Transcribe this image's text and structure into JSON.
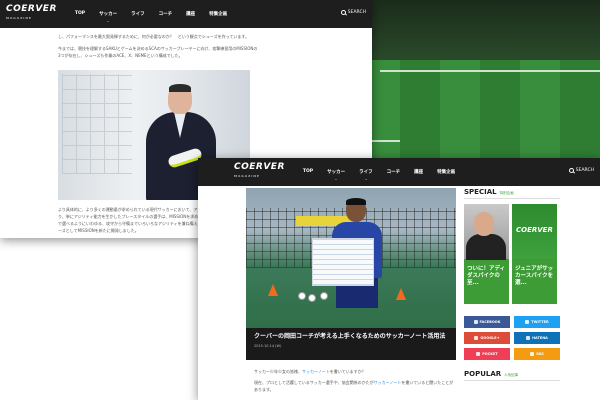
{
  "nav": {
    "logo": "COERVER",
    "logo_sub": "MAGAZINE",
    "items": [
      "TOP",
      "サッカー",
      "ライフ",
      "コーチ",
      "講座",
      "特集企画"
    ],
    "search": "SEARCH"
  },
  "back_article": {
    "para1": "し、パフォーマンスを最大限発揮するために、何が必要なのか？　という観点でシューズを作っています。",
    "para2": "今までは、競技を理解するSAKUとゲームを決めるSCAのサッカープレーヤーに向け、攻撃練習用のMISSIONの3つが存在し、シューズも作業のACE、X、NEMEという構成でした。",
    "para3": "より具体的に、より多くの運動量が求められている現代サッカーにおいて、アジリティが重要になっており、単にアジリティ能力を生かしたプレースタイルの選手は、MISSIONを求めるようになっています。そこで選べるようにいわゆる、攻守から守備までいろいろなアジリティを兼ね備えたシューズとしてのこのシリーズとしてMISSIONを新たに開発しました。"
  },
  "front_article": {
    "caption_title": "クーバーの岡田コーチが考える上手くなるためのサッカーノート活用法",
    "caption_date": "2015.10.14 (W)",
    "text1_a": "サッカー少年少女の皆様、",
    "text1_link": "サッカーノート",
    "text1_b": "を書いていますか？",
    "text2_a": "現在、プロとして活躍しているサッカー選手や、協会関係のかたが",
    "text2_link": "サッカーノート",
    "text2_b": "を書いていると聞いたことがあります。"
  },
  "sidebar": {
    "special_title": "SPECIAL",
    "special_sub": "特別企画",
    "card1_logo": "COERVER",
    "card1_text": "ついに！アディダスパイクの至...",
    "card2_logo": "COERVER",
    "card2_text": "ジュニアがサッカースパイクを選...",
    "shares": [
      {
        "label": "FACEBOOK",
        "color": "#3b5998"
      },
      {
        "label": "TWITTER",
        "color": "#1da1f2"
      },
      {
        "label": "GOOGLE+",
        "color": "#dd4b39"
      },
      {
        "label": "HATENA",
        "color": "#0d72b8"
      },
      {
        "label": "POCKET",
        "color": "#ef3e56"
      },
      {
        "label": "RSS",
        "color": "#f39c12"
      }
    ],
    "popular_title": "POPULAR",
    "popular_sub": "人気記事"
  },
  "colors": {
    "nav_bg": "#1e1e1e",
    "accent_green": "#3d9c36",
    "link_blue": "#1e88e5"
  }
}
